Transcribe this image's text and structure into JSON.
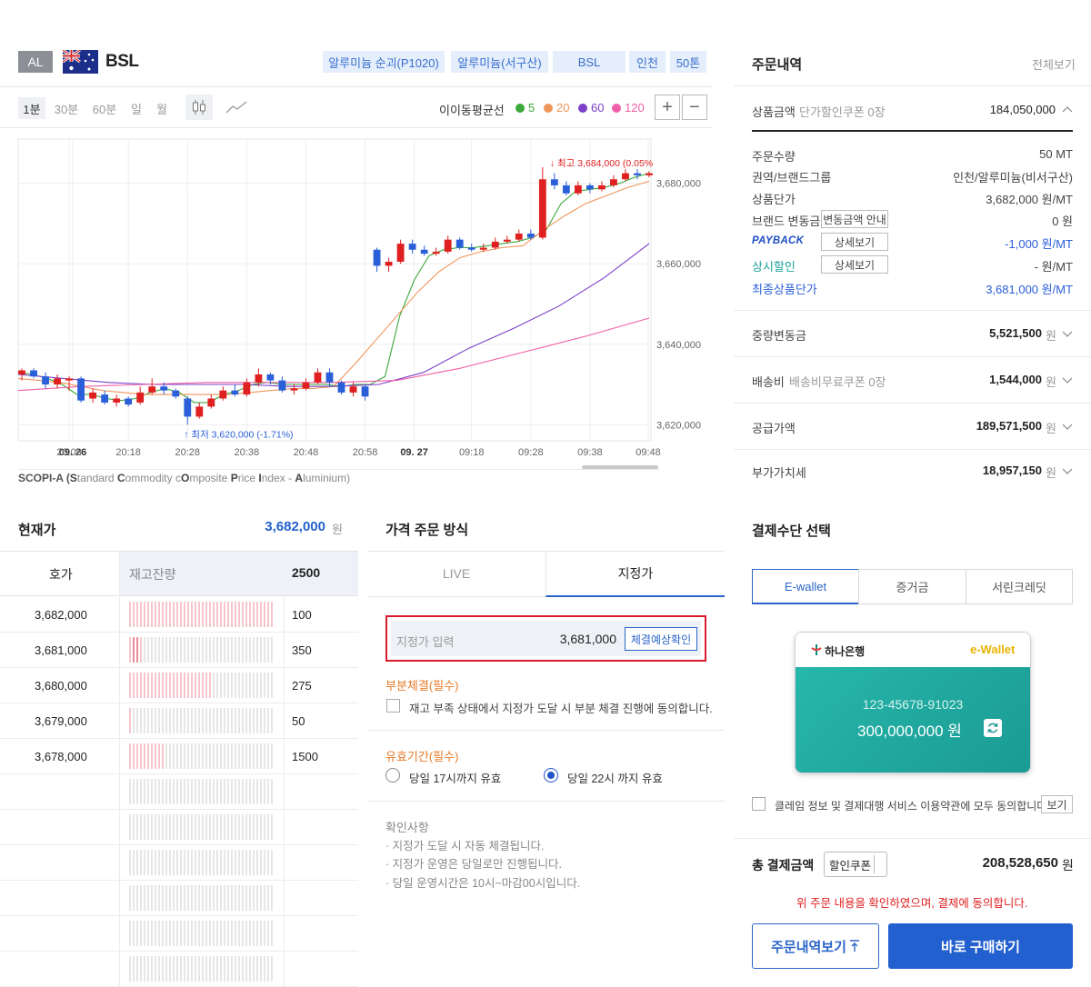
{
  "header": {
    "badge": "AL",
    "symbol": "BSL",
    "tags": [
      "알루미늄 순괴(P1020)",
      "알루미늄(서구산)",
      "BSL",
      "인천",
      "50톤"
    ]
  },
  "chart_toolbar": {
    "timeframes": [
      "1분",
      "30분",
      "60분",
      "일",
      "월"
    ],
    "active_timeframe": "1분",
    "ma_title": "이이동평균선",
    "ma": [
      {
        "label": "5",
        "color": "#3aa83a"
      },
      {
        "label": "20",
        "color": "#f0955a"
      },
      {
        "label": "60",
        "color": "#7b3fc9"
      },
      {
        "label": "120",
        "color": "#ef5fa7"
      }
    ],
    "zoom_in": "+",
    "zoom_out": "−"
  },
  "chart_data": {
    "type": "line",
    "candles": [
      {
        "x": "20:00",
        "open": 3632500,
        "close": 3633500,
        "high": 3634000,
        "low": 3631000
      },
      {
        "x": "20:02",
        "open": 3633500,
        "close": 3632000,
        "high": 3634000,
        "low": 3631500
      },
      {
        "x": "20:04",
        "open": 3632000,
        "close": 3630000,
        "high": 3633000,
        "low": 3629000
      },
      {
        "x": "20:06",
        "open": 3630000,
        "close": 3631500,
        "high": 3632500,
        "low": 3629000
      },
      {
        "x": "20:08",
        "open": 3631000,
        "close": 3631500,
        "high": 3632000,
        "low": 3628500
      },
      {
        "x": "20:10",
        "open": 3631500,
        "close": 3626000,
        "high": 3632000,
        "low": 3625500
      },
      {
        "x": "20:12",
        "open": 3626500,
        "close": 3628000,
        "high": 3629000,
        "low": 3625500
      },
      {
        "x": "20:14",
        "open": 3627500,
        "close": 3625500,
        "high": 3628500,
        "low": 3625000
      },
      {
        "x": "20:16",
        "open": 3625500,
        "close": 3626500,
        "high": 3627500,
        "low": 3624500
      },
      {
        "x": "20:18",
        "open": 3626500,
        "close": 3625000,
        "high": 3627000,
        "low": 3624500
      },
      {
        "x": "20:20",
        "open": 3625500,
        "close": 3628000,
        "high": 3629500,
        "low": 3625000
      },
      {
        "x": "20:22",
        "open": 3628000,
        "close": 3629500,
        "high": 3631500,
        "low": 3627500
      },
      {
        "x": "20:24",
        "open": 3629500,
        "close": 3628500,
        "high": 3630500,
        "low": 3627500
      },
      {
        "x": "20:26",
        "open": 3628500,
        "close": 3627000,
        "high": 3629000,
        "low": 3626500
      },
      {
        "x": "20:28",
        "open": 3626500,
        "close": 3622000,
        "high": 3627000,
        "low": 3620000
      },
      {
        "x": "20:30",
        "open": 3622000,
        "close": 3624500,
        "high": 3625500,
        "low": 3621500
      },
      {
        "x": "20:32",
        "open": 3624500,
        "close": 3626500,
        "high": 3627500,
        "low": 3624000
      },
      {
        "x": "20:34",
        "open": 3626500,
        "close": 3628500,
        "high": 3629500,
        "low": 3626000
      },
      {
        "x": "20:36",
        "open": 3628500,
        "close": 3627500,
        "high": 3630000,
        "low": 3627000
      },
      {
        "x": "20:38",
        "open": 3627500,
        "close": 3630500,
        "high": 3631500,
        "low": 3627000
      },
      {
        "x": "20:40",
        "open": 3630500,
        "close": 3632500,
        "high": 3634000,
        "low": 3629500
      },
      {
        "x": "20:42",
        "open": 3632500,
        "close": 3631000,
        "high": 3633000,
        "low": 3630000
      },
      {
        "x": "20:44",
        "open": 3631000,
        "close": 3628500,
        "high": 3632000,
        "low": 3628000
      },
      {
        "x": "20:46",
        "open": 3628500,
        "close": 3629000,
        "high": 3630000,
        "low": 3627500
      },
      {
        "x": "20:48",
        "open": 3629000,
        "close": 3630500,
        "high": 3631500,
        "low": 3628500
      },
      {
        "x": "20:50",
        "open": 3630500,
        "close": 3633000,
        "high": 3634000,
        "low": 3630000
      },
      {
        "x": "20:52",
        "open": 3633000,
        "close": 3630500,
        "high": 3634000,
        "low": 3629500
      },
      {
        "x": "20:54",
        "open": 3630500,
        "close": 3628000,
        "high": 3631000,
        "low": 3627500
      },
      {
        "x": "20:56",
        "open": 3628000,
        "close": 3629500,
        "high": 3630500,
        "low": 3627000
      },
      {
        "x": "20:58",
        "open": 3629500,
        "close": 3627000,
        "high": 3630000,
        "low": 3626000
      },
      {
        "x": "21:00",
        "open": 3663500,
        "close": 3659500,
        "high": 3664000,
        "low": 3658000
      },
      {
        "x": "21:02",
        "open": 3659500,
        "close": 3660500,
        "high": 3661500,
        "low": 3658000
      },
      {
        "x": "21:04",
        "open": 3660500,
        "close": 3665000,
        "high": 3666000,
        "low": 3660000
      },
      {
        "x": "21:06",
        "open": 3665000,
        "close": 3663500,
        "high": 3666000,
        "low": 3662500
      },
      {
        "x": "21:08",
        "open": 3663500,
        "close": 3662500,
        "high": 3664500,
        "low": 3662000
      },
      {
        "x": "21:10",
        "open": 3662500,
        "close": 3663000,
        "high": 3664000,
        "low": 3662000
      },
      {
        "x": "21:12",
        "open": 3663000,
        "close": 3666000,
        "high": 3667000,
        "low": 3662500
      },
      {
        "x": "21:14",
        "open": 3666000,
        "close": 3664000,
        "high": 3666500,
        "low": 3663500
      },
      {
        "x": "21:16",
        "open": 3664000,
        "close": 3663500,
        "high": 3665000,
        "low": 3663000
      },
      {
        "x": "21:18",
        "open": 3663500,
        "close": 3664000,
        "high": 3665000,
        "low": 3663000
      },
      {
        "x": "21:20",
        "open": 3664000,
        "close": 3665500,
        "high": 3666500,
        "low": 3663500
      },
      {
        "x": "21:22",
        "open": 3665500,
        "close": 3666000,
        "high": 3667000,
        "low": 3665000
      },
      {
        "x": "21:24",
        "open": 3666000,
        "close": 3667500,
        "high": 3668500,
        "low": 3665500
      },
      {
        "x": "21:26",
        "open": 3667500,
        "close": 3666500,
        "high": 3668500,
        "low": 3666000
      },
      {
        "x": "21:28",
        "open": 3666500,
        "close": 3681000,
        "high": 3684000,
        "low": 3666000
      },
      {
        "x": "21:30",
        "open": 3681000,
        "close": 3679500,
        "high": 3682500,
        "low": 3678500
      },
      {
        "x": "21:32",
        "open": 3679500,
        "close": 3677500,
        "high": 3680500,
        "low": 3677000
      },
      {
        "x": "21:34",
        "open": 3677500,
        "close": 3679500,
        "high": 3680500,
        "low": 3677000
      },
      {
        "x": "21:36",
        "open": 3679500,
        "close": 3678500,
        "high": 3680000,
        "low": 3677500
      },
      {
        "x": "21:38",
        "open": 3678500,
        "close": 3679500,
        "high": 3680500,
        "low": 3678000
      },
      {
        "x": "21:40",
        "open": 3679500,
        "close": 3681000,
        "high": 3682000,
        "low": 3679000
      },
      {
        "x": "21:42",
        "open": 3681000,
        "close": 3682500,
        "high": 3683500,
        "low": 3680500
      },
      {
        "x": "21:44",
        "open": 3682500,
        "close": 3682000,
        "high": 3683500,
        "low": 3681000
      },
      {
        "x": "21:46",
        "open": 3682000,
        "close": 3682500,
        "high": 3683000,
        "low": 3681500
      }
    ],
    "ma_series": [
      {
        "name": "5",
        "color": "#3aa83a",
        "values": [
          3633000,
          3632500,
          3631500,
          3630000,
          3627500,
          3627500,
          3626500,
          3626000,
          3626500,
          3628000,
          3629000,
          3628000,
          3625500,
          3625500,
          3627500,
          3628500,
          3630000,
          3630500,
          3630000,
          3630000,
          3630000,
          3630000,
          3629500,
          3630000,
          3630000,
          3632000,
          3647000,
          3656000,
          3662000,
          3663500,
          3664000,
          3664000,
          3664500,
          3665000,
          3665500,
          3666500,
          3668500,
          3675000,
          3678000,
          3678500,
          3679000,
          3680000,
          3681500,
          3682500
        ]
      },
      {
        "name": "20",
        "color": "#f0955a",
        "values": [
          3631500,
          3631000,
          3630500,
          3629500,
          3628500,
          3628000,
          3627500,
          3627500,
          3627500,
          3627500,
          3627500,
          3628000,
          3628500,
          3629000,
          3629000,
          3629500,
          3635000,
          3641000,
          3647000,
          3653000,
          3658000,
          3661500,
          3663000,
          3664000,
          3664500,
          3668500,
          3672000,
          3675000,
          3677000,
          3679000,
          3680500
        ]
      },
      {
        "name": "60",
        "color": "#7b3fc9",
        "values": [
          3632500,
          3631500,
          3630500,
          3630000,
          3630000,
          3630000,
          3629500,
          3629500,
          3630000,
          3633000,
          3639000,
          3644000,
          3649500,
          3656500,
          3665000
        ]
      },
      {
        "name": "120",
        "color": "#ef5fa7",
        "values": [
          3628500,
          3629500,
          3630000,
          3630500,
          3630500,
          3630500,
          3631000,
          3634000,
          3638000,
          3642000,
          3646500
        ]
      }
    ],
    "ylim": [
      3616000,
      3691000
    ],
    "y_ticks": [
      "3,620,000",
      "3,640,000",
      "3,660,000",
      "3,680,000"
    ],
    "x_ticks": [
      {
        "label": "09. 26",
        "bold": true
      },
      {
        "label": "20:08",
        "bold": false
      },
      {
        "label": "20:18",
        "bold": false
      },
      {
        "label": "20:28",
        "bold": false
      },
      {
        "label": "20:38",
        "bold": false
      },
      {
        "label": "20:48",
        "bold": false
      },
      {
        "label": "20:58",
        "bold": false
      },
      {
        "label": "09. 27",
        "bold": true
      },
      {
        "label": "09:18",
        "bold": false
      },
      {
        "label": "09:28",
        "bold": false
      },
      {
        "label": "09:38",
        "bold": false
      },
      {
        "label": "09:48",
        "bold": false
      }
    ],
    "high_annotation": "최고 3,684,000 (0.05%",
    "low_annotation": "최저 3,620,000 (-1.71%)",
    "up_color": "#e02020",
    "down_color": "#2a5fd9",
    "grid": true
  },
  "chart_caption": {
    "c1": "SCOPI-A (",
    "s": "S",
    "t1": "tandard ",
    "c": "C",
    "t2": "ommodity c",
    "o": "O",
    "t3": "mposite ",
    "p": "P",
    "t4": "rice ",
    "i": "I",
    "t5": "ndex - ",
    "a": "A",
    "t6": "luminium)"
  },
  "order_summary": {
    "title": "주문내역",
    "view_all": "전체보기",
    "product_amount": {
      "label": "상품금액",
      "sub": "단가할인쿠폰 0장",
      "value": "184,050,000"
    },
    "details": [
      {
        "label": "주문수량",
        "value": "50 MT"
      },
      {
        "label": "권역/브랜드그룹",
        "value": "인천/알루미늄(비서구산)"
      },
      {
        "label": "상품단가",
        "value": "3,682,000 원/MT"
      },
      {
        "label": "브랜드 변동금",
        "btn": "변동금액 안내",
        "value": "0 원"
      },
      {
        "label": "PAYBACK",
        "btn": "상세보기",
        "value": "-1,000 원/MT"
      },
      {
        "label": "상시할인",
        "btn": "상세보기",
        "value": "- 원/MT"
      },
      {
        "label": "최종상품단가",
        "value": "3,681,000 원/MT"
      }
    ],
    "weight_adj": {
      "label": "중량변동금",
      "value": "5,521,500",
      "unit": "원"
    },
    "shipping": {
      "label": "배송비",
      "sub": "배송비무료쿠폰 0장",
      "value": "1,544,000",
      "unit": "원"
    },
    "supply": {
      "label": "공급가액",
      "value": "189,571,500",
      "unit": "원"
    },
    "vat": {
      "label": "부가가치세",
      "value": "18,957,150",
      "unit": "원"
    }
  },
  "current_price": {
    "label": "현재가",
    "value": "3,682,000",
    "unit": "원"
  },
  "orderbook": {
    "col_price": "호가",
    "col_stock": "재고잔량",
    "total": "2500",
    "rows": [
      {
        "price": "3,682,000",
        "qty": "100",
        "fill": 0.04
      },
      {
        "price": "3,681,000",
        "qty": "350",
        "fill": 0.14
      },
      {
        "price": "3,680,000",
        "qty": "275",
        "fill": 0.11
      },
      {
        "price": "3,679,000",
        "qty": "50",
        "fill": 0.02
      },
      {
        "price": "3,678,000",
        "qty": "1500",
        "fill": 0.6
      }
    ],
    "empty_rows": 6
  },
  "price_order": {
    "title": "가격 주문 방식",
    "tabs": [
      "LIVE",
      "지정가"
    ],
    "active_tab": "지정가",
    "limit_placeholder": "지정가 입력",
    "limit_value": "3,681,000",
    "check_btn": "체결예상확인",
    "partial_title": "부분체결(필수)",
    "partial_text": "재고 부족 상태에서 지정가 도달 시 부분 체결 진행에 동의합니다.",
    "validity_title": "유효기간(필수)",
    "validity_options": [
      "당일 17시까지 유효",
      "당일 22시 까지 유효"
    ],
    "validity_selected": 1,
    "notes_title": "확인사항",
    "notes": [
      "· 지정가 도달 시 자동 체결됩니다.",
      "· 지정가 운영은 당일로만 진행됩니다.",
      "· 당일 운영시간은 10시~마감00시입니다."
    ]
  },
  "payment": {
    "title": "결제수단 선택",
    "tabs": [
      "E-wallet",
      "증거금",
      "서린크레딧"
    ],
    "active_tab": "E-wallet",
    "card": {
      "bank": "하나은행",
      "brand": "e-Wallet",
      "account": "123-45678-91023",
      "balance": "300,000,000 원"
    },
    "agree_text": "클레임 정보 및 결제대행 서비스 이용약관에 모두 동의합니다.",
    "agree_btn": "보기",
    "total_label": "총 결제금액",
    "coupon_btn": "할인쿠폰",
    "total_value": "208,528,650",
    "total_unit": "원",
    "confirm_text": "위 주문 내용을 확인하였으며, 결제에 동의합니다.",
    "btn_order_history": "주문내역보기",
    "btn_buy": "바로 구매하기"
  }
}
